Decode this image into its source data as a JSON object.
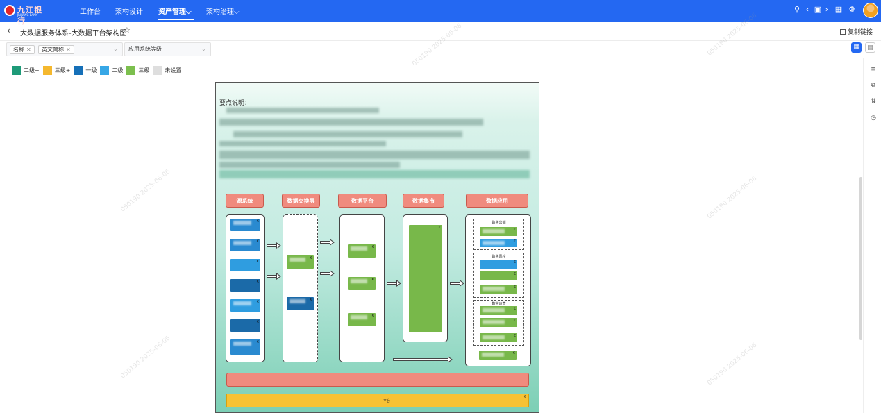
{
  "app": {
    "logo_name": "九江银行",
    "logo_sub": "JIUJIANG BANK",
    "nav": [
      {
        "label": "工作台"
      },
      {
        "label": "架构设计"
      },
      {
        "label": "资产管理⌵"
      },
      {
        "label": "架构治理⌵"
      }
    ]
  },
  "header": {
    "title": "大数据服务体系-大数据平台架构图",
    "copy_link": "复制链接"
  },
  "filters": {
    "chips": [
      "名称",
      "英文简称"
    ],
    "select_placeholder": "应用系统等级"
  },
  "legend": [
    {
      "label": "二级+",
      "color": "#1e9a78"
    },
    {
      "label": "三级+",
      "color": "#f5b82e"
    },
    {
      "label": "一级",
      "color": "#1670b8"
    },
    {
      "label": "二级",
      "color": "#37a7e6"
    },
    {
      "label": "三级",
      "color": "#7cbf4e"
    },
    {
      "label": "未设置",
      "color": "#dedede"
    }
  ],
  "diagram": {
    "notes_title": "要点说明：",
    "sections": [
      "源系统",
      "数据交换层",
      "数据平台",
      "数据集市",
      "数据应用"
    ],
    "groups": [
      "数字营销",
      "数字风控",
      "数字运营"
    ],
    "marker": "€",
    "bottom_yellow_label": "平台"
  },
  "watermark": "050190  2025-06-06"
}
